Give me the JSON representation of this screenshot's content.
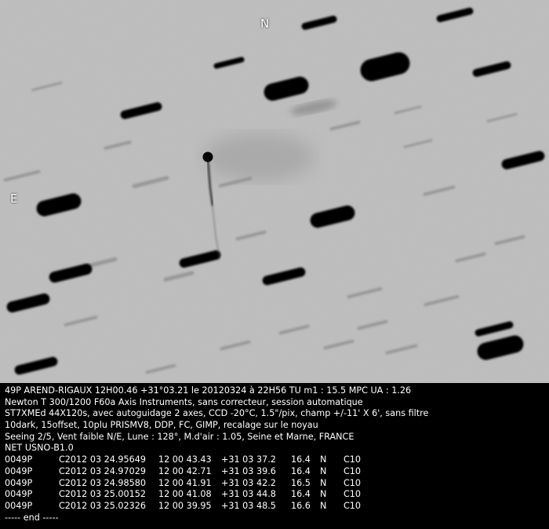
{
  "image": {
    "description_labels": {
      "north": "N",
      "east": "E"
    }
  },
  "info": {
    "lines": [
      "49P AREND-RIGAUX 12H00.46 +31°03.21 le 20120324 à 22H56 TU m1 : 15.5 MPC UA : 1.26",
      "Newton T 300/1200 F60a Axis Instruments, sans correcteur, session automatique",
      "ST7XMEd 44X120s, avec autoguidage 2 axes, CCD -20°C, 1.5\"/pix, champ +/-11' X 6', sans filtre",
      "10dark, 15offset, 10plu PRISMV8, DDP, FC, GIMP, recalage sur le noyau",
      "Seeing 2/5, Vent faible N/E, Lune : 128°, M.d'air : 1.05, Seine et Marne, FRANCE",
      "NET USNO-B1.0"
    ],
    "observations": [
      {
        "object": "0049P",
        "date": "C2012 03 24.95649",
        "ra": "12 00 43.43",
        "dec": "+31 03 37.2",
        "mag": "16.4",
        "band": "N",
        "code": "C10"
      },
      {
        "object": "0049P",
        "date": "C2012 03 24.97029",
        "ra": "12 00 42.71",
        "dec": "+31 03 39.6",
        "mag": "16.4",
        "band": "N",
        "code": "C10"
      },
      {
        "object": "0049P",
        "date": "C2012 03 24.98580",
        "ra": "12 00 41.91",
        "dec": "+31 03 42.2",
        "mag": "16.5",
        "band": "N",
        "code": "C10"
      },
      {
        "object": "0049P",
        "date": "C2012 03 25.00152",
        "ra": "12 00 41.08",
        "dec": "+31 03 44.8",
        "mag": "16.4",
        "band": "N",
        "code": "C10"
      },
      {
        "object": "0049P",
        "date": "C2012 03 25.02326",
        "ra": "12 00 39.95",
        "dec": "+31 03 48.5",
        "mag": "16.6",
        "band": "N",
        "code": "C10"
      }
    ],
    "end_marker": "----- end -----"
  }
}
